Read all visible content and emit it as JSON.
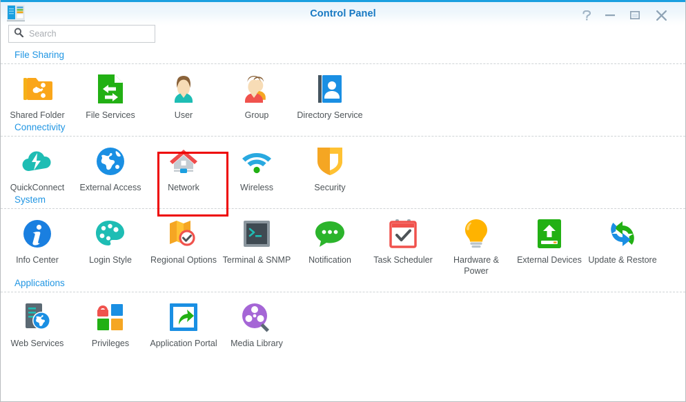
{
  "window": {
    "title": "Control Panel",
    "app_icon": "nas-server-icon",
    "controls": [
      {
        "name": "help-button",
        "glyph": "?"
      },
      {
        "name": "minimize-button",
        "glyph": "—"
      },
      {
        "name": "maximize-button",
        "glyph": "□"
      },
      {
        "name": "close-button",
        "glyph": "✕"
      }
    ]
  },
  "search": {
    "placeholder": "Search",
    "value": "",
    "icon": "search-icon"
  },
  "highlight": {
    "target": "Network",
    "color": "#ee0000"
  },
  "theme": {
    "accent": "#2196e3",
    "title_color": "#1678c2",
    "label_color": "#4e5458",
    "titlebar_top": "#1a9fe0"
  },
  "sections": [
    {
      "title": "File Sharing",
      "items": [
        {
          "label": "Shared Folder",
          "icon": "shared-folder-icon"
        },
        {
          "label": "File Services",
          "icon": "file-services-icon"
        },
        {
          "label": "User",
          "icon": "user-icon"
        },
        {
          "label": "Group",
          "icon": "group-icon"
        },
        {
          "label": "Directory Service",
          "icon": "directory-service-icon"
        }
      ]
    },
    {
      "title": "Connectivity",
      "items": [
        {
          "label": "QuickConnect",
          "icon": "quickconnect-icon"
        },
        {
          "label": "External Access",
          "icon": "external-access-icon"
        },
        {
          "label": "Network",
          "icon": "network-icon",
          "highlighted": true
        },
        {
          "label": "Wireless",
          "icon": "wireless-icon"
        },
        {
          "label": "Security",
          "icon": "security-shield-icon"
        }
      ]
    },
    {
      "title": "System",
      "items": [
        {
          "label": "Info Center",
          "icon": "info-center-icon"
        },
        {
          "label": "Login Style",
          "icon": "login-style-icon"
        },
        {
          "label": "Regional Options",
          "icon": "regional-options-icon"
        },
        {
          "label": "Terminal & SNMP",
          "icon": "terminal-snmp-icon"
        },
        {
          "label": "Notification",
          "icon": "notification-icon"
        },
        {
          "label": "Task Scheduler",
          "icon": "task-scheduler-icon"
        },
        {
          "label": "Hardware & Power",
          "icon": "hardware-power-icon"
        },
        {
          "label": "External Devices",
          "icon": "external-devices-icon"
        },
        {
          "label": "Update & Restore",
          "icon": "update-restore-icon"
        }
      ]
    },
    {
      "title": "Applications",
      "items": [
        {
          "label": "Web Services",
          "icon": "web-services-icon"
        },
        {
          "label": "Privileges",
          "icon": "privileges-icon"
        },
        {
          "label": "Application Portal",
          "icon": "application-portal-icon"
        },
        {
          "label": "Media Library",
          "icon": "media-library-icon"
        }
      ]
    }
  ]
}
